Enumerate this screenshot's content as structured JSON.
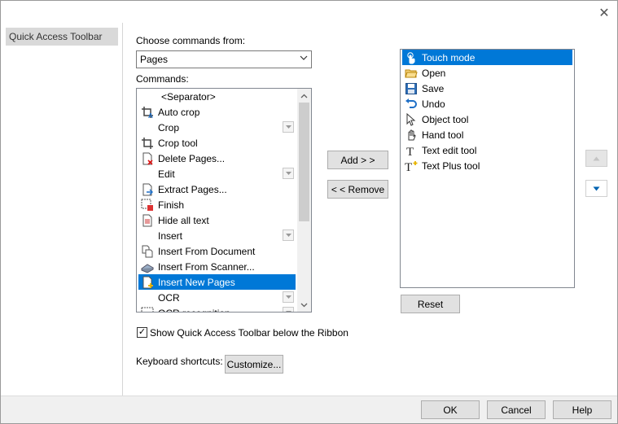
{
  "window": {
    "close_glyph": "✕"
  },
  "nav": {
    "items": [
      {
        "label": "Quick Access Toolbar"
      }
    ]
  },
  "choose": {
    "label": "Choose commands from:",
    "value": "Pages"
  },
  "commands": {
    "label": "Commands:",
    "items": [
      {
        "label": "<Separator>",
        "icon": "none",
        "dropdown": false
      },
      {
        "label": "Auto crop",
        "icon": "auto-crop-icon",
        "dropdown": false
      },
      {
        "label": "Crop",
        "icon": "none",
        "dropdown": true
      },
      {
        "label": "Crop tool",
        "icon": "crop-icon",
        "dropdown": false
      },
      {
        "label": "Delete Pages...",
        "icon": "delete-page-icon",
        "dropdown": false
      },
      {
        "label": "Edit",
        "icon": "none",
        "dropdown": true
      },
      {
        "label": "Extract Pages...",
        "icon": "extract-page-icon",
        "dropdown": false
      },
      {
        "label": "Finish",
        "icon": "finish-icon",
        "dropdown": false
      },
      {
        "label": "Hide all text",
        "icon": "hide-text-icon",
        "dropdown": false
      },
      {
        "label": "Insert",
        "icon": "none",
        "dropdown": true
      },
      {
        "label": "Insert From Document",
        "icon": "insert-document-icon",
        "dropdown": false
      },
      {
        "label": "Insert From Scanner...",
        "icon": "scanner-icon",
        "dropdown": false
      },
      {
        "label": "Insert New Pages",
        "icon": "new-page-icon",
        "dropdown": false,
        "selected": true
      },
      {
        "label": "OCR",
        "icon": "none",
        "dropdown": true
      },
      {
        "label": "OCR recognition",
        "icon": "ocr-icon",
        "dropdown": true
      }
    ]
  },
  "buttons": {
    "add": "Add > >",
    "remove": "< < Remove",
    "reset": "Reset",
    "customize": "Customize...",
    "ok": "OK",
    "cancel": "Cancel",
    "help": "Help"
  },
  "toolbar_list": {
    "items": [
      {
        "label": "Touch mode",
        "icon": "touch-hand-icon",
        "selected": true
      },
      {
        "label": "Open",
        "icon": "folder-open-icon"
      },
      {
        "label": "Save",
        "icon": "save-icon"
      },
      {
        "label": "Undo",
        "icon": "undo-icon"
      },
      {
        "label": "Object tool",
        "icon": "arrow-cursor-icon"
      },
      {
        "label": "Hand tool",
        "icon": "hand-icon"
      },
      {
        "label": "Text edit tool",
        "icon": "text-edit-icon"
      },
      {
        "label": "Text Plus tool",
        "icon": "text-plus-icon"
      }
    ]
  },
  "show_below": {
    "label": "Show Quick Access Toolbar below the Ribbon",
    "checked": true,
    "check_glyph": "✓"
  },
  "keyboard": {
    "label": "Keyboard shortcuts:"
  },
  "colors": {
    "selection": "#0078d7",
    "move_down_arrow": "#0063b1"
  }
}
